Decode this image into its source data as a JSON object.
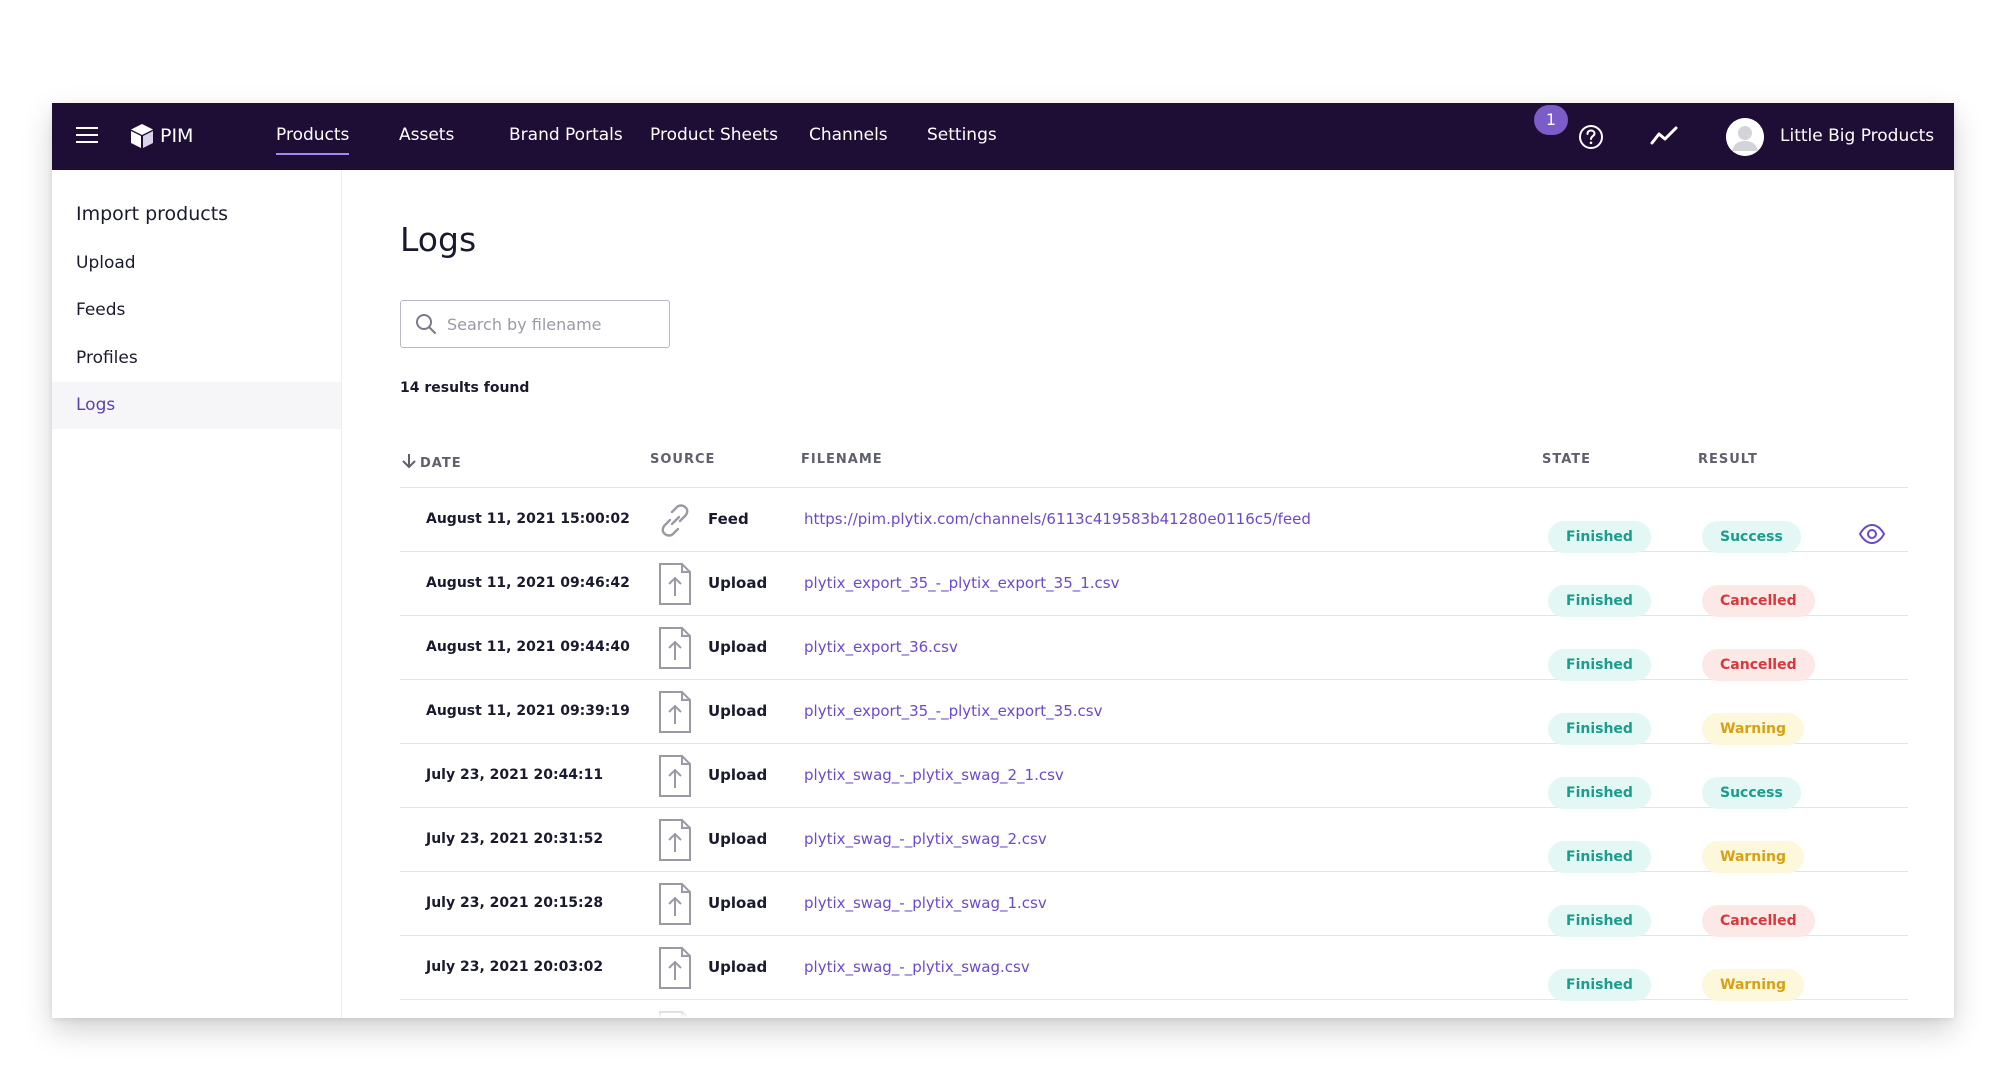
{
  "app": {
    "brand": "PIM",
    "notification_count": "1",
    "account_name": "Little Big Products"
  },
  "nav": {
    "items": [
      {
        "label": "Products",
        "active": true
      },
      {
        "label": "Assets"
      },
      {
        "label": "Brand Portals"
      },
      {
        "label": "Product Sheets"
      },
      {
        "label": "Channels"
      },
      {
        "label": "Settings"
      }
    ]
  },
  "sidebar": {
    "title": "Import products",
    "items": [
      {
        "label": "Upload"
      },
      {
        "label": "Feeds"
      },
      {
        "label": "Profiles"
      },
      {
        "label": "Logs",
        "active": true
      }
    ]
  },
  "main": {
    "title": "Logs",
    "search_placeholder": "Search by filename",
    "results_text": "14 results found",
    "columns": {
      "date": "DATE",
      "source": "SOURCE",
      "filename": "FILENAME",
      "state": "STATE",
      "result": "RESULT"
    },
    "rows": [
      {
        "date": "August 11, 2021 15:00:02",
        "source": "Feed",
        "source_icon": "link-icon",
        "filename": "https://pim.plytix.com/channels/6113c419583b41280e0116c5/feed",
        "state": "Finished",
        "result": "Success",
        "has_view": true
      },
      {
        "date": "August 11, 2021 09:46:42",
        "source": "Upload",
        "source_icon": "upload-file-icon",
        "filename": "plytix_export_35_-_plytix_export_35_1.csv",
        "state": "Finished",
        "result": "Cancelled"
      },
      {
        "date": "August 11, 2021 09:44:40",
        "source": "Upload",
        "source_icon": "upload-file-icon",
        "filename": "plytix_export_36.csv",
        "state": "Finished",
        "result": "Cancelled"
      },
      {
        "date": "August 11, 2021 09:39:19",
        "source": "Upload",
        "source_icon": "upload-file-icon",
        "filename": "plytix_export_35_-_plytix_export_35.csv",
        "state": "Finished",
        "result": "Warning"
      },
      {
        "date": "July 23, 2021 20:44:11",
        "source": "Upload",
        "source_icon": "upload-file-icon",
        "filename": "plytix_swag_-_plytix_swag_2_1.csv",
        "state": "Finished",
        "result": "Success"
      },
      {
        "date": "July 23, 2021 20:31:52",
        "source": "Upload",
        "source_icon": "upload-file-icon",
        "filename": "plytix_swag_-_plytix_swag_2.csv",
        "state": "Finished",
        "result": "Warning"
      },
      {
        "date": "July 23, 2021 20:15:28",
        "source": "Upload",
        "source_icon": "upload-file-icon",
        "filename": "plytix_swag_-_plytix_swag_1.csv",
        "state": "Finished",
        "result": "Cancelled"
      },
      {
        "date": "July 23, 2021 20:03:02",
        "source": "Upload",
        "source_icon": "upload-file-icon",
        "filename": "plytix_swag_-_plytix_swag.csv",
        "state": "Finished",
        "result": "Warning"
      },
      {
        "date": "",
        "source": "",
        "source_icon": "upload-file-icon",
        "filename": "",
        "state": "",
        "result": ""
      }
    ]
  },
  "colors": {
    "topbar": "#1e0d35",
    "accent": "#6b4ac9",
    "success": "#1a9e8c",
    "cancelled": "#d8373c",
    "warning": "#d8a111"
  }
}
